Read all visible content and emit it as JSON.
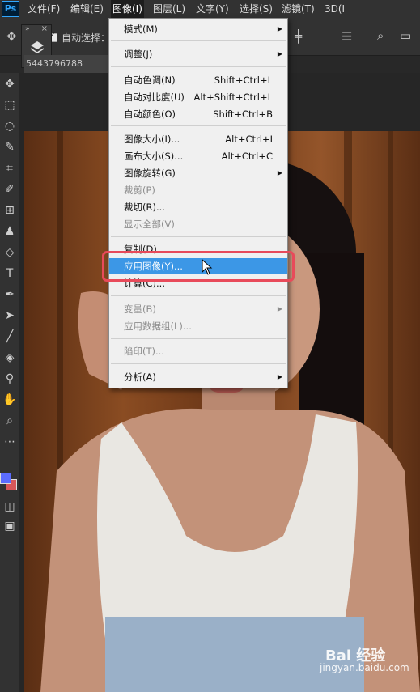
{
  "app": {
    "logo": "Ps"
  },
  "menubar": {
    "items": [
      "文件(F)",
      "编辑(E)",
      "图像(I)",
      "图层(L)",
      "文字(Y)",
      "选择(S)",
      "滤镜(T)",
      "3D(I"
    ]
  },
  "options": {
    "auto_select_label": "自动选择：",
    "auto_select_checked": true
  },
  "document": {
    "tab_label": "5443796788"
  },
  "image_menu": {
    "items": [
      {
        "label": "模式(M)",
        "shortcut": "",
        "submenu": true,
        "disabled": false
      },
      {
        "label": "调整(J)",
        "shortcut": "",
        "submenu": true,
        "disabled": false
      },
      {
        "label": "自动色调(N)",
        "shortcut": "Shift+Ctrl+L",
        "submenu": false,
        "disabled": false
      },
      {
        "label": "自动对比度(U)",
        "shortcut": "Alt+Shift+Ctrl+L",
        "submenu": false,
        "disabled": false
      },
      {
        "label": "自动颜色(O)",
        "shortcut": "Shift+Ctrl+B",
        "submenu": false,
        "disabled": false
      },
      {
        "label": "图像大小(I)...",
        "shortcut": "Alt+Ctrl+I",
        "submenu": false,
        "disabled": false
      },
      {
        "label": "画布大小(S)...",
        "shortcut": "Alt+Ctrl+C",
        "submenu": false,
        "disabled": false
      },
      {
        "label": "图像旋转(G)",
        "shortcut": "",
        "submenu": true,
        "disabled": false
      },
      {
        "label": "裁剪(P)",
        "shortcut": "",
        "submenu": false,
        "disabled": true
      },
      {
        "label": "裁切(R)...",
        "shortcut": "",
        "submenu": false,
        "disabled": false
      },
      {
        "label": "显示全部(V)",
        "shortcut": "",
        "submenu": false,
        "disabled": true
      },
      {
        "label": "复制(D)...",
        "shortcut": "",
        "submenu": false,
        "disabled": false
      },
      {
        "label": "应用图像(Y)...",
        "shortcut": "",
        "submenu": false,
        "disabled": false,
        "highlighted": true
      },
      {
        "label": "计算(C)...",
        "shortcut": "",
        "submenu": false,
        "disabled": false
      },
      {
        "label": "变量(B)",
        "shortcut": "",
        "submenu": true,
        "disabled": true
      },
      {
        "label": "应用数据组(L)...",
        "shortcut": "",
        "submenu": false,
        "disabled": true
      },
      {
        "label": "陷印(T)...",
        "shortcut": "",
        "submenu": false,
        "disabled": true
      },
      {
        "label": "分析(A)",
        "shortcut": "",
        "submenu": true,
        "disabled": false
      }
    ]
  },
  "watermark": {
    "brand": "Bai 经验",
    "site": "jingyan.baidu.com"
  },
  "colors": {
    "foreground": "#5b6cff",
    "background": "#d9575a",
    "highlight": "#3c97e6",
    "annotation": "#e84a5a"
  }
}
